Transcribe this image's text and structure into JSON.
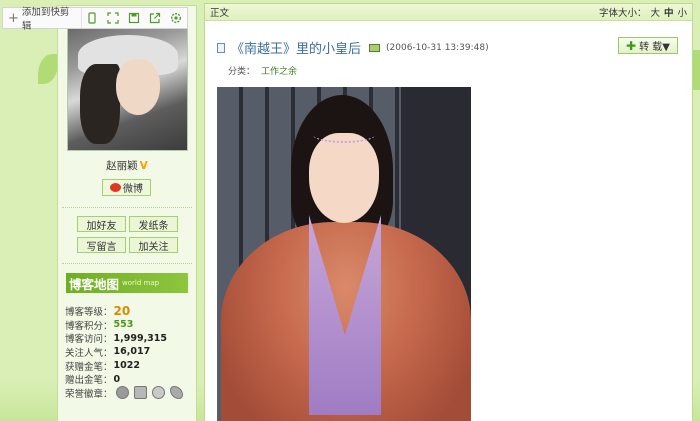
{
  "toolbar": {
    "clip_label": "添加到快剪辑",
    "icons": [
      "phone-icon",
      "fullscreen-icon",
      "save-icon",
      "share-icon",
      "settings-icon"
    ]
  },
  "profile": {
    "name": "赵丽颖",
    "weibo_label": "微博",
    "actions": {
      "add_friend": "加好友",
      "send_note": "发纸条",
      "leave_message": "写留言",
      "follow": "加关注"
    },
    "map_banner": "博客地图",
    "map_banner_sub": "world map",
    "stats": [
      {
        "label": "博客等级：",
        "value": "20"
      },
      {
        "label": "博客积分：",
        "value": "553"
      },
      {
        "label": "博客访问：",
        "value": "1,999,315"
      },
      {
        "label": "关注人气：",
        "value": "16,017"
      },
      {
        "label": "获赠金笔：",
        "value": "1022"
      },
      {
        "label": "赠出金笔：",
        "value": "0"
      },
      {
        "label": "荣誉徽章：",
        "value": ""
      }
    ]
  },
  "post": {
    "header_label": "正文",
    "font_size_label": "字体大小：",
    "font_sizes": [
      "大",
      "中",
      "小"
    ],
    "title": "《南越王》里的小皇后",
    "date": "(2006-10-31 13:39:48)",
    "repost_label": "转 载▼",
    "category_label": "分类：",
    "category_value": "工作之余"
  },
  "colors": {
    "accent_green": "#6fae22",
    "title_blue": "#3b6fa0",
    "background": "#d9efb5"
  }
}
